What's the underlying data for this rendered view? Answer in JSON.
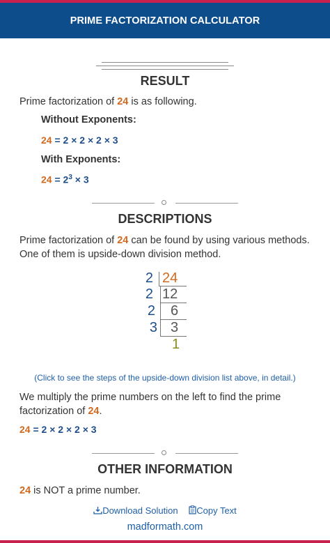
{
  "header": {
    "title": "PRIME FACTORIZATION CALCULATOR"
  },
  "colors": {
    "header_bg": "#0e4d8b",
    "accent_stripe": "#c8214e",
    "number_orange": "#d2691e",
    "factor_blue": "#1f4e8c",
    "link_blue": "#1f5fa8"
  },
  "result": {
    "title": "RESULT",
    "intro_pre": "Prime factorization of ",
    "number": "24",
    "intro_post": " is as following.",
    "without_label": "Without Exponents:",
    "without_rhs": "= 2 × 2 × 2 × 3",
    "with_label": "With Exponents:",
    "with_eq_pre": "= 2",
    "with_exp": "3",
    "with_eq_post": " × 3"
  },
  "descriptions": {
    "title": "DESCRIPTIONS",
    "p1_pre": "Prime factorization of ",
    "p1_post": " can be found by using various methods.",
    "p2": "One of them is upside-down division method.",
    "ladder": {
      "divisors": [
        "2",
        "2",
        "2",
        "3"
      ],
      "quotients": [
        "24",
        "12",
        "6",
        "3"
      ],
      "final": "1"
    },
    "steps_link": "(Click to see the steps of the upside-down division list above, in detail.)",
    "p3": "We multiply the prime numbers on the left to find the prime",
    "p4_pre": "factorization of ",
    "p4_post": ".",
    "eq_rhs": "= 2 × 2 × 2 × 3"
  },
  "other": {
    "title": "OTHER INFORMATION",
    "text_post": " is NOT a prime number."
  },
  "footer": {
    "download": "Download Solution",
    "copy": "Copy Text",
    "site": "madformath.com"
  }
}
